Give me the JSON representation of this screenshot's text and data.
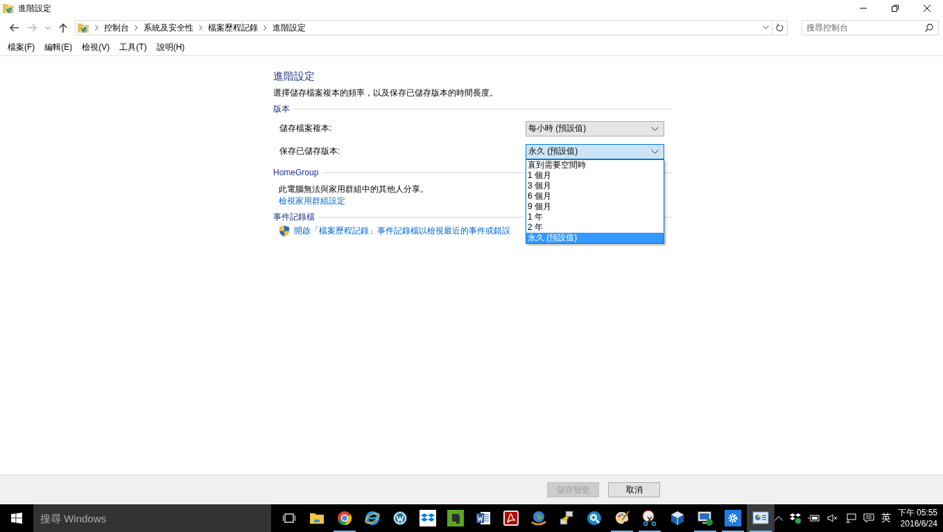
{
  "window": {
    "title": "進階設定"
  },
  "address_bar": {
    "breadcrumb": [
      "控制台",
      "系統及安全性",
      "檔案歷程記錄",
      "進階設定"
    ],
    "search": {
      "placeholder": "搜尋控制台"
    }
  },
  "menu": [
    "檔案(F)",
    "編輯(E)",
    "檢視(V)",
    "工具(T)",
    "說明(H)"
  ],
  "content": {
    "heading": "進階設定",
    "description": "選擇儲存檔案複本的頻率，以及保存已儲存版本的時間長度。",
    "sections": [
      {
        "kind": "settings",
        "title": "版本",
        "rows": [
          {
            "label": "儲存檔案複本:",
            "value": "每小時 (預設值)",
            "open": false
          },
          {
            "label": "保存已儲存版本:",
            "value": "永久 (預設值)",
            "open": true,
            "options": [
              {
                "label": "直到需要空間時",
                "selected": false
              },
              {
                "label": "1 個月",
                "selected": false
              },
              {
                "label": "3 個月",
                "selected": false
              },
              {
                "label": "6 個月",
                "selected": false
              },
              {
                "label": "9 個月",
                "selected": false
              },
              {
                "label": "1 年",
                "selected": false
              },
              {
                "label": "2 年",
                "selected": false
              },
              {
                "label": "永久 (預設值)",
                "selected": true
              }
            ]
          }
        ]
      },
      {
        "kind": "text",
        "title": "HomeGroup",
        "text": "此電腦無法與家用群組中的其他人分享。",
        "link": "檢視家用群組設定"
      },
      {
        "kind": "shield_link",
        "title": "事件記錄檔",
        "link": "開啟「檔案歷程記錄」事件記錄檔以檢視最近的事件或錯誤"
      }
    ]
  },
  "footer": {
    "buttons": [
      {
        "label": "儲存變更",
        "disabled": true
      },
      {
        "label": "取消",
        "disabled": false
      }
    ]
  },
  "taskbar": {
    "search_placeholder": "搜尋 Windows",
    "apps": [
      {
        "kind": "folder",
        "running": false,
        "active": false
      },
      {
        "kind": "chrome",
        "running": true,
        "active": false
      },
      {
        "kind": "ie",
        "running": false,
        "active": false
      },
      {
        "kind": "wordpress",
        "running": false,
        "active": false
      },
      {
        "kind": "dropbox",
        "running": false,
        "active": false
      },
      {
        "kind": "evernote",
        "running": false,
        "active": false
      },
      {
        "kind": "word",
        "running": false,
        "active": false
      },
      {
        "kind": "acrobat",
        "running": false,
        "active": false
      },
      {
        "kind": "globe",
        "running": false,
        "active": false
      },
      {
        "kind": "network",
        "running": false,
        "active": false
      },
      {
        "kind": "magnifier",
        "running": false,
        "active": false
      },
      {
        "kind": "paint",
        "running": true,
        "active": false
      },
      {
        "kind": "scissors",
        "running": true,
        "active": false
      },
      {
        "kind": "cube",
        "running": false,
        "active": false
      },
      {
        "kind": "monitor",
        "running": true,
        "active": false
      },
      {
        "kind": "gear",
        "running": true,
        "active": false
      },
      {
        "kind": "panel",
        "running": true,
        "active": true
      }
    ],
    "ime": "英",
    "time": "下午 05:55",
    "date": "2016/6/24"
  }
}
